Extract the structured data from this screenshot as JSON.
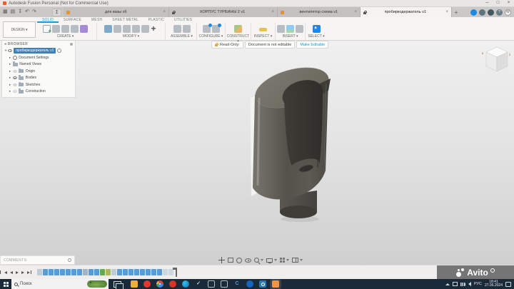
{
  "ui": {
    "caret": "▾",
    "close_glyph": "×",
    "tree_arrow": "▸",
    "tree_arrow_open": "▾",
    "collapse_glyph": "◂",
    "plus_glyph": "+",
    "help_glyph": "?"
  },
  "titlebar": {
    "title": "Autodesk Fusion Personal (Not for Commercial Use)",
    "controls": {
      "minimize": "─",
      "maximize": "□",
      "close": "×"
    }
  },
  "quick_access": {
    "icons": [
      {
        "name": "application-menu-icon",
        "glyph": "▦"
      },
      {
        "name": "file-new-icon",
        "glyph": "▤"
      },
      {
        "name": "save-icon",
        "glyph": "↧"
      },
      {
        "name": "undo-icon",
        "glyph": "↶"
      },
      {
        "name": "redo-icon",
        "glyph": "↷"
      }
    ],
    "share_glyph": "↥"
  },
  "doc_tabs": {
    "items": [
      {
        "label": "для вазы v6",
        "icon": "doc-orange",
        "active": false
      },
      {
        "label": "КОРПУС ТУРБИНЫ 2 v1",
        "icon": "lock",
        "active": false
      },
      {
        "label": "вентилятор схема v1",
        "icon": "doc-orange",
        "active": false
      },
      {
        "label": "пробиркодержатель v1",
        "icon": "lock",
        "active": true
      }
    ],
    "new_tab_label": "+",
    "account_initial": "W"
  },
  "ribbon": {
    "design_label": "DESIGN ▾",
    "tabs": [
      {
        "label": "SOLID",
        "active": true
      },
      {
        "label": "SURFACE",
        "active": false
      },
      {
        "label": "MESH",
        "active": false
      },
      {
        "label": "SHEET METAL",
        "active": false
      },
      {
        "label": "PLASTIC",
        "active": false
      },
      {
        "label": "UTILITIES",
        "active": false
      }
    ],
    "groups": [
      "CREATE ▾",
      "MODIFY ▾",
      "ASSEMBLE ▾",
      "CONFIGURE ▾",
      "CONSTRUCT ▾",
      "INSPECT ▾",
      "INSERT ▾",
      "SELECT ▾"
    ],
    "group_icons": {
      "create": [
        {
          "name": "create-sketch-icon",
          "cls": "t-sketch"
        },
        {
          "name": "extrude-icon",
          "cls": "t-gray"
        },
        {
          "name": "revolve-icon",
          "cls": "t-gray"
        },
        {
          "name": "sweep-icon",
          "cls": "t-gray"
        },
        {
          "name": "create-form-icon",
          "cls": "t-purple"
        }
      ],
      "modify": [
        {
          "name": "press-pull-icon",
          "cls": "t-blue"
        },
        {
          "name": "fillet-icon",
          "cls": "t-gray"
        },
        {
          "name": "shell-icon",
          "cls": "t-gray"
        },
        {
          "name": "combine-icon",
          "cls": "t-gray"
        },
        {
          "name": "offset-face-icon",
          "cls": "t-gray"
        },
        {
          "name": "move-copy-icon",
          "cls": "t-move"
        }
      ],
      "assemble": [
        {
          "name": "new-component-icon",
          "cls": "t-gray"
        },
        {
          "name": "joint-icon",
          "cls": "t-gray"
        }
      ],
      "configure": [
        {
          "name": "configuration-icon",
          "cls": "t-cfg"
        },
        {
          "name": "configuration-table-icon",
          "cls": "t-cfg"
        }
      ],
      "construct": [
        {
          "name": "construction-plane-icon",
          "cls": "t-planes"
        }
      ],
      "inspect": [
        {
          "name": "measure-icon",
          "cls": "t-measure"
        }
      ],
      "insert": [
        {
          "name": "insert-derive-icon",
          "cls": "t-gray"
        },
        {
          "name": "decal-icon",
          "cls": "t-img"
        },
        {
          "name": "insert-mesh-icon",
          "cls": "t-gray"
        }
      ],
      "select": [
        {
          "name": "select-icon",
          "cls": "t-sel"
        }
      ]
    }
  },
  "readonly_banner": {
    "label": "Read-Only:",
    "message": "Document is not editable",
    "action": "Make Editable"
  },
  "browser": {
    "title": "BROWSER",
    "root_label": "пробиркодержатель v1",
    "items": [
      "Document Settings",
      "Named Views",
      "Origin",
      "Bodies",
      "Sketches",
      "Construction"
    ]
  },
  "viewcube": {
    "axis_left": "x",
    "axis_right": "z"
  },
  "viewport_nav": {
    "icons": [
      {
        "name": "pan-icon",
        "cls": "ic-pan"
      },
      {
        "name": "fit-icon",
        "cls": "ic-fit"
      },
      {
        "name": "orbit-icon",
        "cls": "ic-orbit"
      },
      {
        "name": "look-at-icon",
        "cls": "ic-look"
      },
      {
        "name": "zoom-icon",
        "cls": "ic-zoom"
      },
      {
        "name": "caret-down-icon",
        "cls": "nvc"
      },
      {
        "name": "display-settings-icon",
        "cls": "ic-display"
      },
      {
        "name": "caret-down-icon",
        "cls": "nvc"
      },
      {
        "name": "grid-display-icon",
        "cls": "ic-grid"
      },
      {
        "name": "caret-down-icon",
        "cls": "nvc"
      },
      {
        "name": "viewports-icon",
        "cls": "ic-views"
      },
      {
        "name": "caret-down-icon",
        "cls": "nvc"
      }
    ]
  },
  "comments_bar": {
    "title": "COMMENTS"
  },
  "timeline": {
    "controls": [
      {
        "name": "go-to-start-button",
        "cls": "pb-start"
      },
      {
        "name": "step-back-button",
        "cls": "pb-prev"
      },
      {
        "name": "play-button",
        "cls": "pb-play"
      },
      {
        "name": "step-forward-button",
        "cls": "pb-next"
      },
      {
        "name": "go-to-end-button",
        "cls": "pb-end"
      }
    ],
    "icons": [
      "#bccdd8",
      "#5b9bd5",
      "#5b9bd5",
      "#5b9bd5",
      "#5b9bd5",
      "#5b9bd5",
      "#5b9bd5",
      "#5b9bd5",
      "#9fb6c2",
      "#5b9bd5",
      "#5b9bd5",
      "#6aa84f",
      "#a8b85a",
      "#bccdd8",
      "#5b9bd5",
      "#5b9bd5",
      "#5b9bd5",
      "#5b9bd5",
      "#5b9bd5",
      "#5b9bd5",
      "#5b9bd5",
      "#5b9bd5",
      "#ccd8de",
      "#ccd8de"
    ]
  },
  "watermark": {
    "text": "Avito"
  },
  "taskbar": {
    "search_placeholder": "Поиск",
    "apps": [
      {
        "name": "file-explorer-icon",
        "color": "#f0ad3e"
      },
      {
        "name": "red-app-icon",
        "color": "#e0392b",
        "cls": "circle"
      },
      {
        "name": "chrome-icon",
        "cls": "chrome circle"
      },
      {
        "name": "yandex-browser-icon",
        "color": "#d63426",
        "cls": "circle"
      },
      {
        "name": "edge-icon",
        "cls": "edge circle"
      },
      {
        "name": "check-app-icon",
        "glyph": "✓",
        "cls": "ghost"
      },
      {
        "name": "window-app-icon",
        "cls": "frame"
      },
      {
        "name": "window-app-icon-2",
        "cls": "frame"
      },
      {
        "name": "compass-3d-app-icon",
        "glyph": "C",
        "cls": "ghost-blue"
      },
      {
        "name": "blue-circle-app-icon",
        "color": "#1565c0",
        "cls": "circle"
      },
      {
        "name": "blue-ring-app-icon",
        "cls": "ring"
      },
      {
        "name": "fusion-360-app-icon",
        "color": "#f29443",
        "active": true
      }
    ],
    "tray": {
      "language": "РУС",
      "time": "18:41",
      "date": "27.06.2024"
    }
  }
}
